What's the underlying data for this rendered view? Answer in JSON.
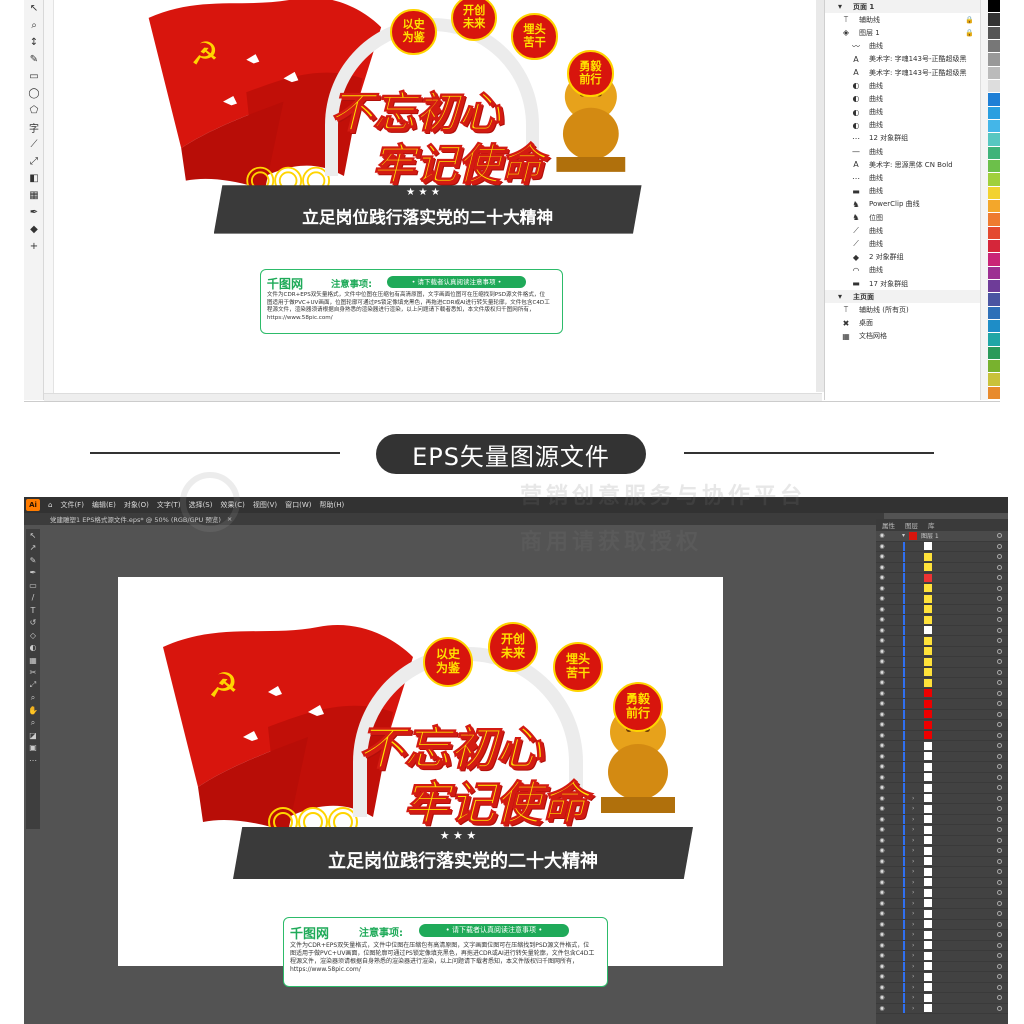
{
  "corel": {
    "tools": [
      "↖",
      "⌕",
      "↕",
      "✎",
      "▭",
      "◯",
      "⬠",
      "字",
      "⟋",
      "⤢",
      "◧",
      "▦",
      "✒",
      "◆",
      "+"
    ],
    "panel": {
      "top_label": "页面 1",
      "rows": [
        {
          "icon": "⟙",
          "label": "辅助线"
        },
        {
          "icon": "◈",
          "label": "图层 1"
        },
        {
          "icon": "〰",
          "label": "曲线"
        },
        {
          "icon": "A",
          "label": "美术字: 字魂143号-正酷超级黑"
        },
        {
          "icon": "A",
          "label": "美术字: 字魂143号-正酷超级黑"
        },
        {
          "icon": "◐",
          "label": "曲线"
        },
        {
          "icon": "◐",
          "label": "曲线"
        },
        {
          "icon": "◐",
          "label": "曲线"
        },
        {
          "icon": "◐",
          "label": "曲线"
        },
        {
          "icon": "⋯",
          "label": "12 对象群组"
        },
        {
          "icon": "—",
          "label": "曲线"
        },
        {
          "icon": "A",
          "label": "美术字: 思源黑体 CN Bold"
        },
        {
          "icon": "⋯",
          "label": "曲线"
        },
        {
          "icon": "▬",
          "label": "曲线"
        },
        {
          "icon": "♞",
          "label": "PowerClip 曲线"
        },
        {
          "icon": "♞",
          "label": "位图"
        },
        {
          "icon": "⟋",
          "label": "曲线"
        },
        {
          "icon": "⟋",
          "label": "曲线"
        },
        {
          "icon": "◆",
          "label": "2 对象群组"
        },
        {
          "icon": "◠",
          "label": "曲线"
        },
        {
          "icon": "▬",
          "label": "17 对象群组"
        }
      ],
      "master_label": "主页面",
      "master_rows": [
        {
          "icon": "⟙",
          "label": "辅助线 (所有页)"
        },
        {
          "icon": "✖",
          "label": "桌面"
        },
        {
          "icon": "▦",
          "label": "文档网格"
        }
      ]
    },
    "palette": [
      "#000000",
      "#333333",
      "#555555",
      "#777777",
      "#999999",
      "#bbbbbb",
      "#dddddd",
      "#1e7fd6",
      "#2a9fe0",
      "#44b6e8",
      "#57c7c1",
      "#3fb37a",
      "#6cc04a",
      "#a0d03c",
      "#f2d230",
      "#f3a72b",
      "#ee7b2f",
      "#e4492f",
      "#d5263a",
      "#c92477",
      "#9d2f92",
      "#6e3c98",
      "#4a55a2",
      "#2e70b8",
      "#1e8dc7",
      "#20a6a6",
      "#2b9a5a",
      "#78b22e",
      "#c9c23a",
      "#e88a2c"
    ]
  },
  "banner": {
    "label": "EPS矢量图源文件"
  },
  "watermark": {
    "line1": "营销创意服务与协作平台",
    "line2": "商用请获取授权"
  },
  "ai": {
    "logo": "Ai",
    "menus": [
      "文件(F)",
      "编辑(E)",
      "对象(O)",
      "文字(T)",
      "选择(S)",
      "效果(C)",
      "视图(V)",
      "窗口(W)",
      "帮助(H)"
    ],
    "tab": "党建雕塑1 EPS格式源文件.eps* @ 50% (RGB/GPU 预览)",
    "panel_tabs": [
      "属性",
      "图层",
      "库"
    ],
    "layer_name": "图层 1",
    "tools": [
      "↖",
      "↗",
      "✎",
      "✒",
      "▭",
      "/",
      "T",
      "↺",
      "◇",
      "◐",
      "▦",
      "✂",
      "⤢",
      "⌕",
      "✋",
      "⌕",
      "◪",
      "▣",
      "⋯"
    ]
  },
  "design": {
    "badges": [
      "以史\n为鉴",
      "开创\n未来",
      "埋头\n苦干",
      "勇毅\n前行"
    ],
    "slogan_line1": "不忘初心",
    "slogan_line2": "牢记使命",
    "stars": "★ ★ ★",
    "subtitle": "立足岗位践行落实党的二十大精神",
    "notice": {
      "brand": "千图网",
      "title": "注意事项:",
      "pill": "• 请下载者认真阅读注意事项 •",
      "body": "文件为CDR+EPS双矢量格式，文件中位图在压缩包有高清原图，文字画面位图可在压缩找到PSD源文件格式，位图适用于做PVC+UV画面，位图轮廓可通过PS锁定像填充黑色，再拖进CDR或AI进行转矢量轮廓，文件包含C4D工程源文件，渲染器须请根据自身熟悉的渲染器进行渲染，以上问题请下载者悉知，本文件版权归千图网所有，https://www.58pic.com/"
    }
  }
}
